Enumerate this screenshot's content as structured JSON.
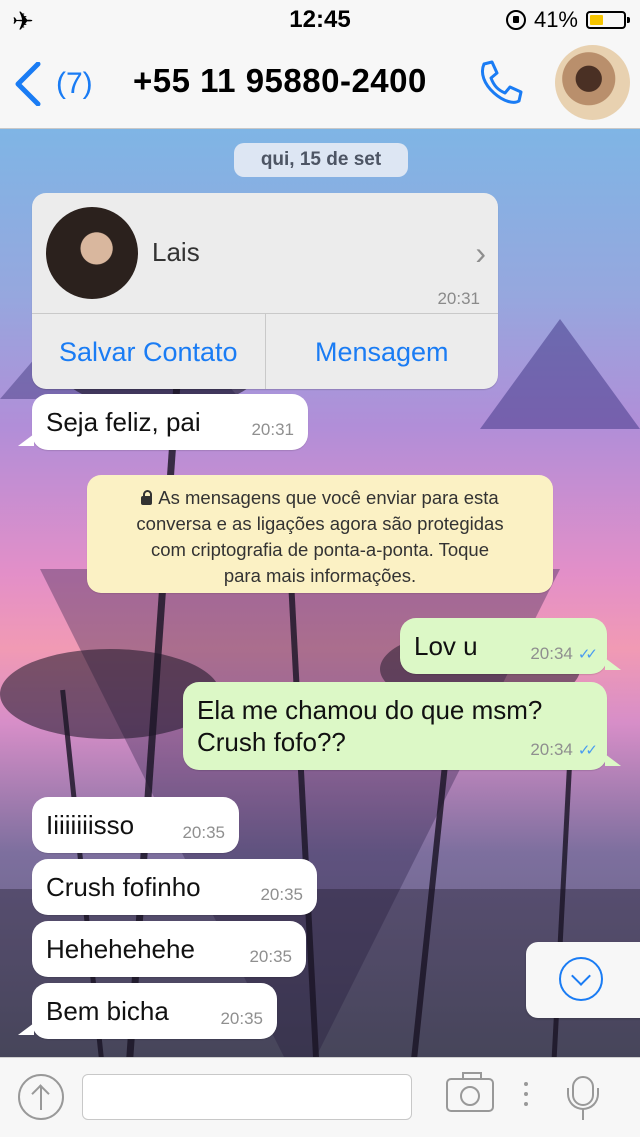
{
  "status_bar": {
    "time": "12:45",
    "battery": "41%",
    "battery_level": 0.41
  },
  "nav": {
    "back_count": "(7)",
    "title": "+55 11 95880-2400"
  },
  "chat": {
    "date": "qui, 15 de set",
    "contact_card": {
      "name": "Lais",
      "time": "20:31",
      "save_label": "Salvar Contato",
      "message_label": "Mensagem"
    },
    "messages": [
      {
        "dir": "in",
        "text": "Seja feliz, pai",
        "time": "20:31"
      },
      {
        "dir": "out",
        "text": "Lov u",
        "time": "20:34"
      },
      {
        "dir": "out",
        "text": "Ela me chamou do que msm?",
        "text2": "Crush fofo??",
        "time": "20:34"
      },
      {
        "dir": "in",
        "text": "Iiiiiiiisso",
        "time": "20:35"
      },
      {
        "dir": "in",
        "text": "Crush fofinho",
        "time": "20:35"
      },
      {
        "dir": "in",
        "text": "Hehehehehe",
        "time": "20:35"
      },
      {
        "dir": "in",
        "text": "Bem bicha",
        "time": "20:35"
      }
    ],
    "encryption_notice": [
      "As mensagens que você enviar para esta",
      "conversa e as ligações agora são protegidas",
      "com criptografia de ponta-a-ponta. Toque",
      "para mais informações."
    ]
  },
  "colors": {
    "accent": "#1a7cf4",
    "outgoing_bubble": "#dcf8c6",
    "notice": "#fbf1c4"
  },
  "icons": [
    "airplane-icon",
    "rotation-lock-icon",
    "battery-icon",
    "back-chevron-icon",
    "phone-icon",
    "chevron-right-icon",
    "lock-icon",
    "double-check-icon",
    "scroll-down-icon",
    "share-icon",
    "camera-icon",
    "mic-icon"
  ]
}
